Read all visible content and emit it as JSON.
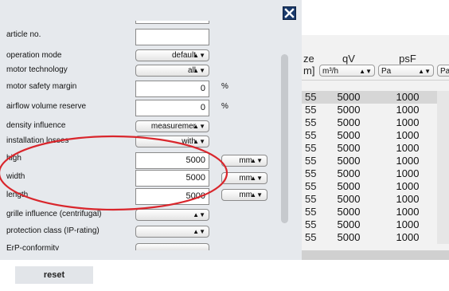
{
  "table": {
    "headers": [
      {
        "top": "ze",
        "bottom": "m]"
      },
      {
        "top": "qV",
        "unit": "m³/h"
      },
      {
        "top": "psF",
        "unit": "Pa"
      },
      {
        "unit": "Pa"
      }
    ],
    "rows": [
      {
        "c1": "55",
        "qv": "5000",
        "psf": "1000"
      },
      {
        "c1": "55",
        "qv": "5000",
        "psf": "1000"
      },
      {
        "c1": "55",
        "qv": "5000",
        "psf": "1000"
      },
      {
        "c1": "55",
        "qv": "5000",
        "psf": "1000"
      },
      {
        "c1": "55",
        "qv": "5000",
        "psf": "1000"
      },
      {
        "c1": "55",
        "qv": "5000",
        "psf": "1000"
      },
      {
        "c1": "55",
        "qv": "5000",
        "psf": "1000"
      },
      {
        "c1": "55",
        "qv": "5000",
        "psf": "1000"
      },
      {
        "c1": "55",
        "qv": "5000",
        "psf": "1000"
      },
      {
        "c1": "55",
        "qv": "5000",
        "psf": "1000"
      },
      {
        "c1": "55",
        "qv": "5000",
        "psf": "1000"
      },
      {
        "c1": "55",
        "qv": "5000",
        "psf": "1000"
      }
    ]
  },
  "form": {
    "fields": {
      "article_no": {
        "label": "article no.",
        "value": ""
      },
      "operation_mode": {
        "label": "operation mode",
        "value": "default"
      },
      "motor_technology": {
        "label": "motor technology",
        "value": "all"
      },
      "motor_safety_margin": {
        "label": "motor safety margin",
        "value": "0",
        "unit": "%"
      },
      "airflow_volume_reserve": {
        "label": "airflow volume reserve",
        "value": "0",
        "unit": "%"
      },
      "density_influence": {
        "label": "density influence",
        "value": "measuremer"
      },
      "installation_losses": {
        "label": "installation losses",
        "value": "with"
      },
      "high": {
        "label": "high",
        "value": "5000",
        "unit": "mm"
      },
      "width": {
        "label": "width",
        "value": "5000",
        "unit": "mm"
      },
      "length": {
        "label": "length",
        "value": "5000",
        "unit": "mm"
      },
      "grille_influence": {
        "label": "grille influence (centrifugal)",
        "value": ""
      },
      "protection_class": {
        "label": "protection class (IP-rating)",
        "value": ""
      },
      "erp_conformity": {
        "label": "ErP-conformity",
        "value": ""
      }
    },
    "arrow": "▲▼"
  },
  "reset_label": "reset",
  "annotation": {
    "color": "#d9262c",
    "icon": "ellipse-highlight"
  },
  "close_icon": "close-icon"
}
